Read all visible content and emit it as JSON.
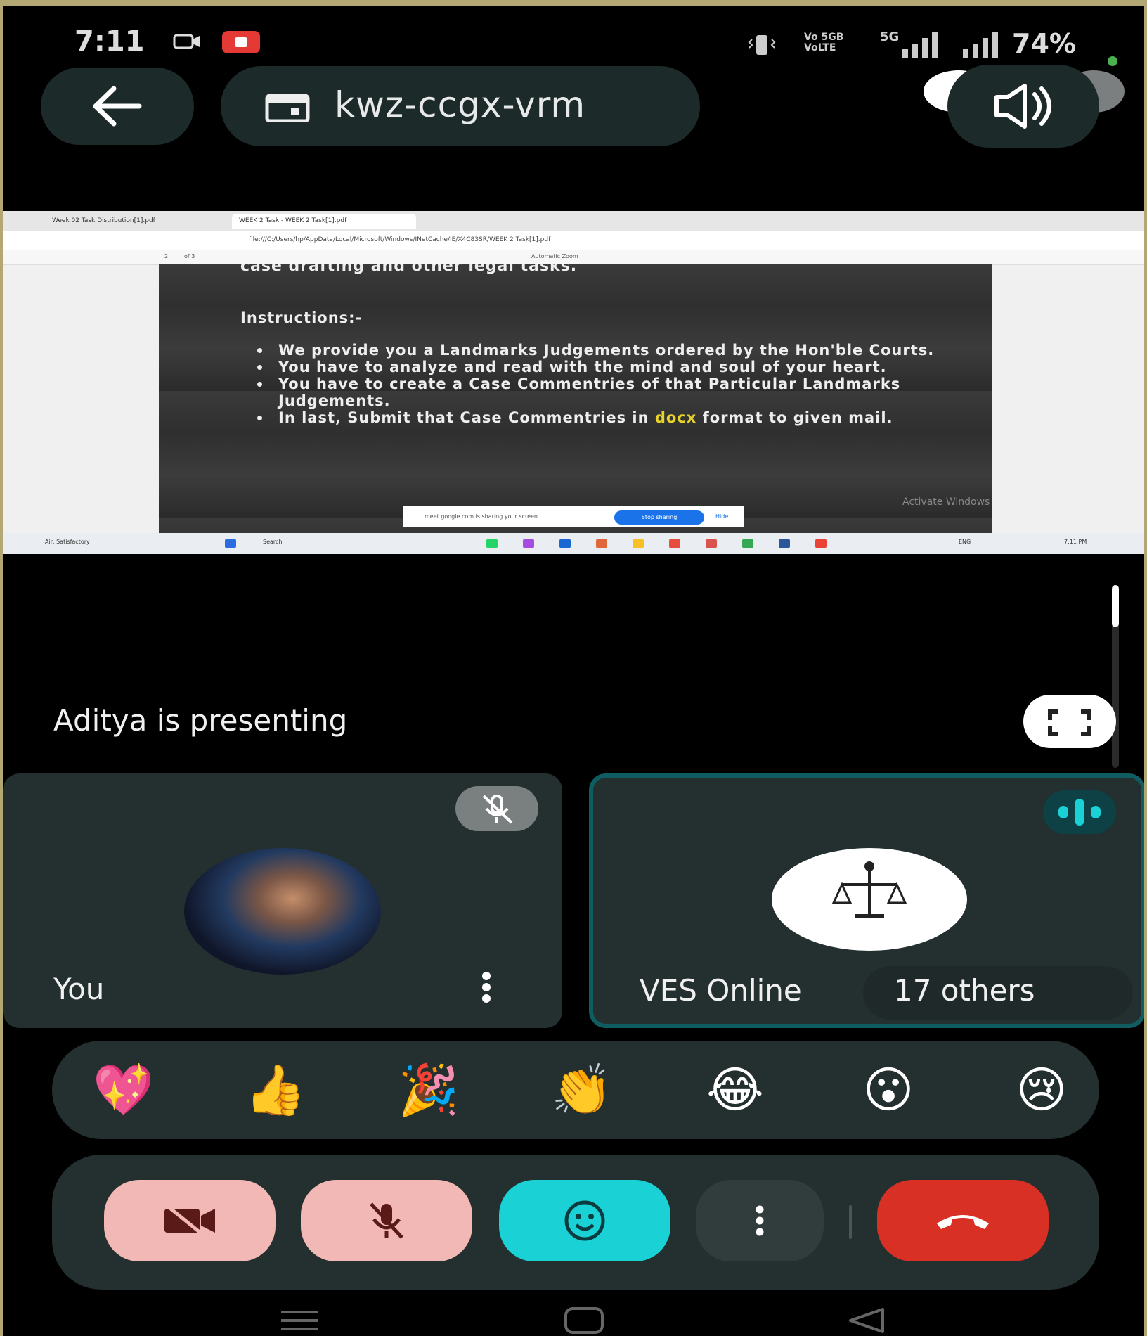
{
  "status_bar": {
    "time": "7:11",
    "network_label": "Vo 5GB\nVoLTE",
    "net_5g": "5G",
    "battery": "74%"
  },
  "top_bar": {
    "meeting_code": "kwz-ccgx-vrm"
  },
  "shared_screen": {
    "tabs": [
      "Week 02 Task Distribution[1].pdf",
      "WEEK 2 Task - WEEK 2 Task[1].pdf"
    ],
    "url": "file:///C:/Users/hp/AppData/Local/Microsoft/Windows/INetCache/IE/X4C83SR/WEEK 2 Task[1].pdf",
    "page_indicator": "2",
    "page_of": "of 3",
    "zoom": "Automatic Zoom",
    "doc_top_line": "case drafting and other legal tasks.",
    "instructions_heading": "Instructions:-",
    "instructions": [
      {
        "pre": "We provide you a Landmarks Judgements ordered by the Hon'ble Courts.",
        "hl": "",
        "post": ""
      },
      {
        "pre": "You have to analyze and read with the mind and soul of your heart.",
        "hl": "",
        "post": ""
      },
      {
        "pre": "You have to create a Case Commentries of that Particular Landmarks Judgements.",
        "hl": "",
        "post": ""
      },
      {
        "pre": "In last, Submit that Case Commentries in ",
        "hl": "docx",
        "post": " format to given mail."
      }
    ],
    "activate_windows": "Activate Windows",
    "share_banner_text": "meet.google.com is sharing your screen.",
    "stop_sharing": "Stop sharing",
    "hide": "Hide",
    "taskbar_weather": "Air: Satisfactory",
    "taskbar_search": "Search",
    "taskbar_lang": "ENG",
    "taskbar_time": "7:11 PM"
  },
  "presenting": {
    "text": "Aditya is presenting"
  },
  "tiles": {
    "you": {
      "name": "You",
      "muted": true
    },
    "ves": {
      "name": "VES Online",
      "others": "17 others",
      "speaking": true
    }
  },
  "reactions": [
    "💖",
    "👍",
    "🎉",
    "👏",
    "😂",
    "😮",
    "😢"
  ],
  "controls": {
    "camera": "camera-off",
    "mic": "mic-off",
    "reactions": "emoji",
    "more": "more",
    "end": "end-call"
  },
  "colors": {
    "tile_bg": "#24302f",
    "active_border": "#0f5d60",
    "accent_teal": "#1ad1d6",
    "muted_pink": "#f2b8b5",
    "end_red": "#d93025"
  }
}
